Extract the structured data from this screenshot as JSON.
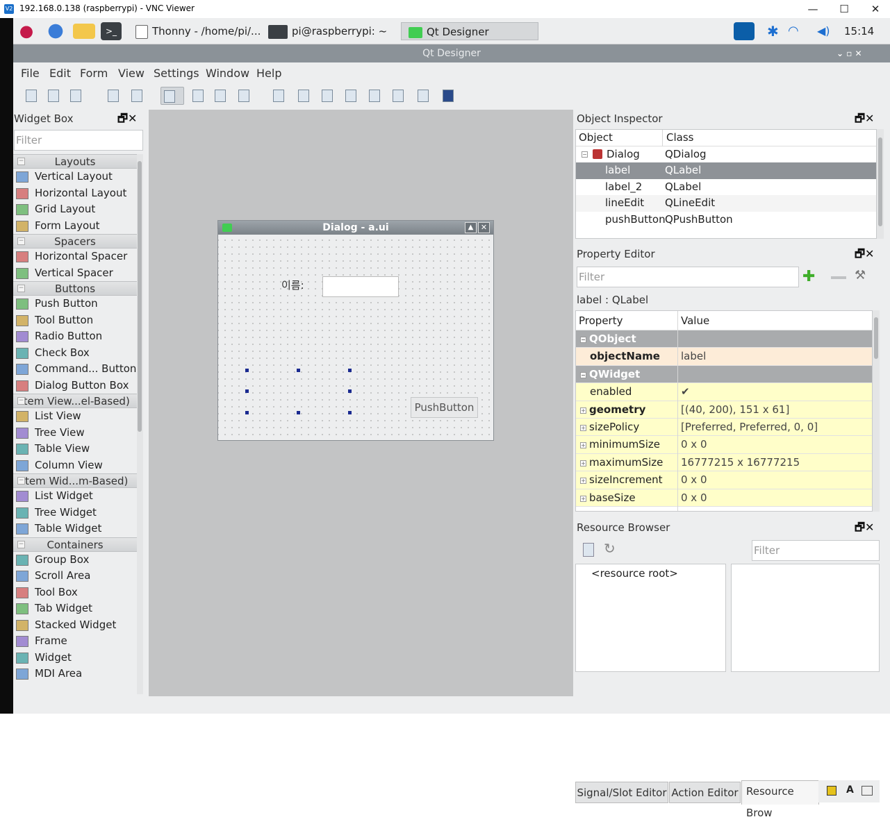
{
  "vnc": {
    "title": "192.168.0.138 (raspberrypi) - VNC Viewer",
    "logo": "V2",
    "min": "—",
    "max": "☐",
    "close": "✕"
  },
  "taskbar": {
    "tasks": [
      "Thonny  -  /home/pi/...",
      "pi@raspberrypi: ~",
      "Qt Designer"
    ],
    "clock": "15:14"
  },
  "window": {
    "title": "Qt Designer",
    "controls": "⌄  ▫  ✕"
  },
  "menu": {
    "file": "File",
    "edit": "Edit",
    "form": "Form",
    "view": "View",
    "settings": "Settings",
    "window": "Window",
    "help": "Help"
  },
  "widget_box": {
    "title": "Widget Box",
    "filter_placeholder": "Filter",
    "categories": [
      {
        "label": "Layouts",
        "items": [
          "Vertical Layout",
          "Horizontal Layout",
          "Grid Layout",
          "Form Layout"
        ]
      },
      {
        "label": "Spacers",
        "items": [
          "Horizontal Spacer",
          "Vertical Spacer"
        ]
      },
      {
        "label": "Buttons",
        "items": [
          "Push Button",
          "Tool Button",
          "Radio Button",
          "Check Box",
          "Command... Button",
          "Dialog Button Box"
        ]
      },
      {
        "label": "Item View...el-Based)",
        "items": [
          "List View",
          "Tree View",
          "Table View",
          "Column View"
        ]
      },
      {
        "label": "Item Wid...m-Based)",
        "items": [
          "List Widget",
          "Tree Widget",
          "Table Widget"
        ]
      },
      {
        "label": "Containers",
        "items": [
          "Group Box",
          "Scroll Area",
          "Tool Box",
          "Tab Widget",
          "Stacked Widget",
          "Frame",
          "Widget",
          "MDI Area"
        ]
      }
    ]
  },
  "dialog": {
    "title": "Dialog - a.ui",
    "label": "이름:",
    "button": "PushButton"
  },
  "object_inspector": {
    "title": "Object Inspector",
    "col_object": "Object",
    "col_class": "Class",
    "rows": [
      {
        "object": "Dialog",
        "class": "QDialog"
      },
      {
        "object": "label",
        "class": "QLabel"
      },
      {
        "object": "label_2",
        "class": "QLabel"
      },
      {
        "object": "lineEdit",
        "class": "QLineEdit"
      },
      {
        "object": "pushButton",
        "class": "QPushButton"
      }
    ],
    "selected": 1
  },
  "property_editor": {
    "title": "Property Editor",
    "filter_placeholder": "Filter",
    "context": "label : QLabel",
    "col_property": "Property",
    "col_value": "Value",
    "rows": [
      {
        "type": "section",
        "property": "QObject",
        "value": ""
      },
      {
        "type": "orange",
        "property": "objectName",
        "value": "label",
        "bold": true
      },
      {
        "type": "section",
        "property": "QWidget",
        "value": ""
      },
      {
        "type": "yellow",
        "property": "enabled",
        "value": "✔"
      },
      {
        "type": "yellow",
        "property": "geometry",
        "value": "[(40, 200), 151 x 61]",
        "bold": true,
        "expand": true
      },
      {
        "type": "yellow",
        "property": "sizePolicy",
        "value": "[Preferred, Preferred, 0, 0]",
        "expand": true
      },
      {
        "type": "yellow",
        "property": "minimumSize",
        "value": "0 x 0",
        "expand": true
      },
      {
        "type": "yellow",
        "property": "maximumSize",
        "value": "16777215 x 16777215",
        "expand": true
      },
      {
        "type": "yellow",
        "property": "sizeIncrement",
        "value": "0 x 0",
        "expand": true
      },
      {
        "type": "yellow",
        "property": "baseSize",
        "value": "0 x 0",
        "expand": true
      }
    ]
  },
  "resource_browser": {
    "title": "Resource Browser",
    "filter_placeholder": "Filter",
    "root": "<resource root>"
  },
  "bottom_tabs": [
    "Signal/Slot Editor",
    "Action Editor",
    "Resource Brow"
  ],
  "dock_ctl": "🗗✕"
}
